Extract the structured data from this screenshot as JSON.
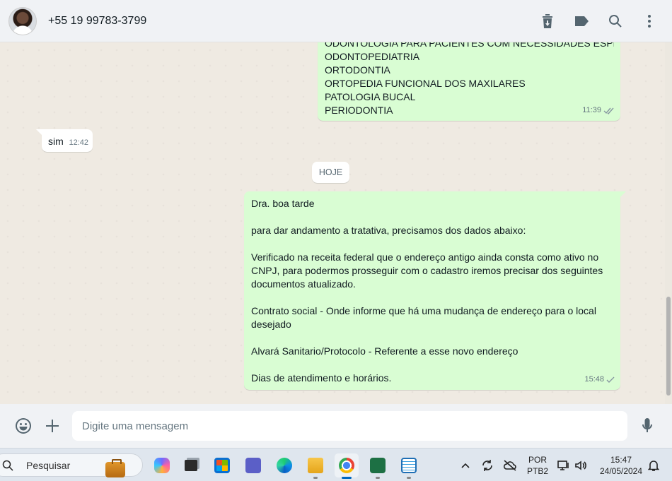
{
  "header": {
    "contact_name": "+55 19 99783-3799",
    "icons": [
      "archive-icon",
      "label-icon",
      "search-icon",
      "menu-icon"
    ]
  },
  "messages": {
    "specialties_cut": "ODONTOLOGIA PARA PACIENTES COM NECESSIDADES ESPECIAIS",
    "specialties": [
      "ODONTOPEDIATRIA",
      "ORTODONTIA",
      "ORTOPEDIA FUNCIONAL DOS MAXILARES",
      "PATOLOGIA BUCAL",
      "PERIODONTIA"
    ],
    "specialties_time": "11:39",
    "reply_text": "sim",
    "reply_time": "12:42",
    "day_label": "HOJE",
    "last_lines": [
      "Dra. boa tarde",
      "",
      "para dar andamento a tratativa, precisamos dos dados abaixo:",
      "",
      "Verificado na receita federal que o endereço antigo ainda consta como ativo no",
      "CNPJ, para podermos prosseguir com o cadastro iremos precisar dos seguintes",
      "documentos atualizado.",
      "",
      "Contrato social - Onde informe que há uma mudança de endereço para o local",
      "desejado",
      "",
      "Alvará Sanitario/Protocolo - Referente a esse novo endereço",
      "",
      "Dias de atendimento e horários."
    ],
    "last_time": "15:48"
  },
  "composer": {
    "placeholder": "Digite uma mensagem"
  },
  "taskbar": {
    "search_label": "Pesquisar",
    "language_top": "POR",
    "language_bottom": "PTB2",
    "time": "15:47",
    "date": "24/05/2024"
  },
  "colors": {
    "outgoing_bubble": "#d9fdd3",
    "incoming_bubble": "#ffffff",
    "chat_bg": "#efeae2",
    "read_tick": "#53bdeb"
  }
}
